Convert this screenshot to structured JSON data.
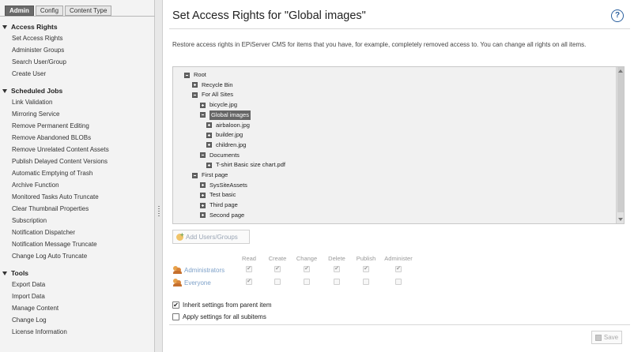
{
  "sidebar": {
    "tabs": [
      "Admin",
      "Config",
      "Content Type"
    ],
    "sections": [
      {
        "title": "Access Rights",
        "items": [
          "Set Access Rights",
          "Administer Groups",
          "Search User/Group",
          "Create User"
        ]
      },
      {
        "title": "Scheduled Jobs",
        "items": [
          "Link Validation",
          "Mirroring Service",
          "Remove Permanent Editing",
          "Remove Abandoned BLOBs",
          "Remove Unrelated Content Assets",
          "Publish Delayed Content Versions",
          "Automatic Emptying of Trash",
          "Archive Function",
          "Monitored Tasks Auto Truncate",
          "Clear Thumbnail Properties",
          "Subscription",
          "Notification Dispatcher",
          "Notification Message Truncate",
          "Change Log Auto Truncate"
        ]
      },
      {
        "title": "Tools",
        "items": [
          "Export Data",
          "Import Data",
          "Manage Content",
          "Change Log",
          "License Information"
        ]
      }
    ]
  },
  "main": {
    "title": "Set Access Rights for \"Global images\"",
    "help": "?",
    "description": "Restore access rights in EPiServer CMS for items that you have, for example, completely removed access to. You can change all rights on all items.",
    "tree": [
      {
        "label": "Root",
        "level": 0,
        "expanded": true
      },
      {
        "label": "Recycle Bin",
        "level": 1,
        "expanded": false
      },
      {
        "label": "For All Sites",
        "level": 1,
        "expanded": true
      },
      {
        "label": "bicycle.jpg",
        "level": 2,
        "expanded": false
      },
      {
        "label": "Global images",
        "level": 2,
        "expanded": true,
        "selected": true
      },
      {
        "label": "airbaloon.jpg",
        "level": 3,
        "expanded": false
      },
      {
        "label": "builder.jpg",
        "level": 3,
        "expanded": false
      },
      {
        "label": "children.jpg",
        "level": 3,
        "expanded": false
      },
      {
        "label": "Documents",
        "level": 2,
        "expanded": true
      },
      {
        "label": "T-shirt Basic size chart.pdf",
        "level": 3,
        "expanded": false
      },
      {
        "label": "First page",
        "level": 1,
        "expanded": true
      },
      {
        "label": "SysSiteAssets",
        "level": 2,
        "expanded": false
      },
      {
        "label": "Test basic",
        "level": 2,
        "expanded": false
      },
      {
        "label": "Third page",
        "level": 2,
        "expanded": false
      },
      {
        "label": "Second page",
        "level": 2,
        "expanded": false
      }
    ],
    "add_users_label": "Add Users/Groups",
    "permission_columns": [
      "Read",
      "Create",
      "Change",
      "Delete",
      "Publish",
      "Administer"
    ],
    "permissions": [
      {
        "name": "Administrators",
        "rights": [
          true,
          true,
          true,
          true,
          true,
          true
        ]
      },
      {
        "name": "Everyone",
        "rights": [
          true,
          false,
          false,
          false,
          false,
          false
        ]
      }
    ],
    "options": [
      {
        "label": "Inherit settings from parent item",
        "checked": true
      },
      {
        "label": "Apply settings for all subitems",
        "checked": false
      }
    ],
    "save_label": "Save"
  }
}
